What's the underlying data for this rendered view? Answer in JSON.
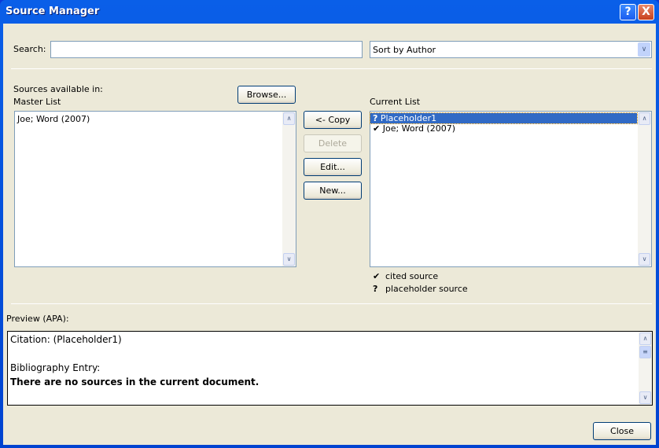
{
  "window": {
    "title": "Source Manager",
    "help": "?",
    "close": "X"
  },
  "search": {
    "label": "Search:",
    "value": "",
    "placeholder": ""
  },
  "sort": {
    "value": "Sort by Author"
  },
  "sources_label": "Sources available in:",
  "master": {
    "label": "Master List",
    "items": [
      "Joe; Word (2007)"
    ]
  },
  "browse": "Browse...",
  "buttons": {
    "copy": "<- Copy",
    "delete": "Delete",
    "edit": "Edit...",
    "new": "New..."
  },
  "current": {
    "label": "Current List",
    "items": [
      {
        "mark": "?",
        "text": "Placeholder1",
        "selected": true
      },
      {
        "mark": "✔",
        "text": "Joe; Word (2007)",
        "selected": false
      }
    ]
  },
  "legend": [
    {
      "mark": "✔",
      "text": "cited source"
    },
    {
      "mark": "?",
      "text": "placeholder source"
    }
  ],
  "preview": {
    "label": "Preview (APA):",
    "citation": "Citation:  (Placeholder1)",
    "bib_label": "Bibliography Entry:",
    "bib_text": "There are no sources in the current document."
  },
  "close_btn": "Close"
}
